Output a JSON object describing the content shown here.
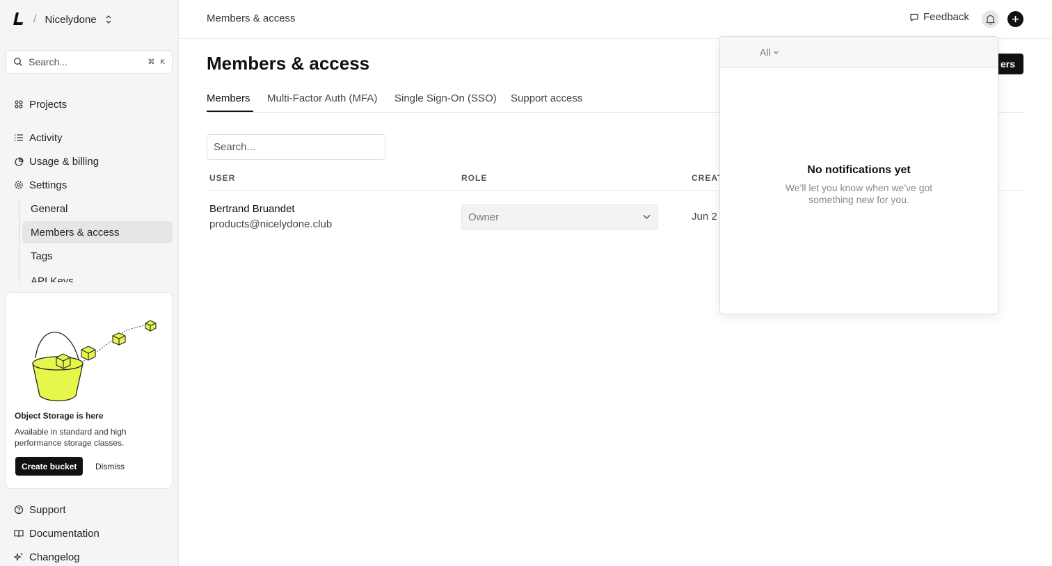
{
  "sidebar": {
    "org_name": "Nicelydone",
    "separator": "/",
    "search_placeholder": "Search...",
    "search_shortcut": [
      "⌘",
      "K"
    ],
    "nav": {
      "projects": "Projects",
      "activity": "Activity",
      "usage_billing": "Usage & billing",
      "settings": "Settings"
    },
    "settings_sub": {
      "general": "General",
      "members_access": "Members & access",
      "tags": "Tags",
      "api_keys": "API Keys"
    },
    "promo": {
      "title": "Object Storage is here",
      "description": "Available in standard and high performance storage classes.",
      "create_button": "Create bucket",
      "dismiss_button": "Dismiss",
      "accent_color": "#e4f74a"
    },
    "footer": {
      "support": "Support",
      "documentation": "Documentation",
      "changelog": "Changelog"
    }
  },
  "header": {
    "breadcrumb": "Members & access",
    "feedback_label": "Feedback"
  },
  "main": {
    "title": "Members & access",
    "invite_button_visible": "ers",
    "tabs": [
      "Members",
      "Multi-Factor Auth (MFA)",
      "Single Sign-On (SSO)",
      "Support access"
    ],
    "active_tab": "Members",
    "search_placeholder": "Search...",
    "table": {
      "columns": [
        "USER",
        "ROLE",
        "CREAT"
      ],
      "rows": [
        {
          "name": "Bertrand Bruandet",
          "email": "products@nicelydone.club",
          "role": "Owner",
          "created": "Jun 2"
        }
      ]
    }
  },
  "notifications": {
    "filter": "All",
    "empty_title": "No notifications yet",
    "empty_desc_line1": "We'll let you know when we've got",
    "empty_desc_line2": "something new for you."
  }
}
